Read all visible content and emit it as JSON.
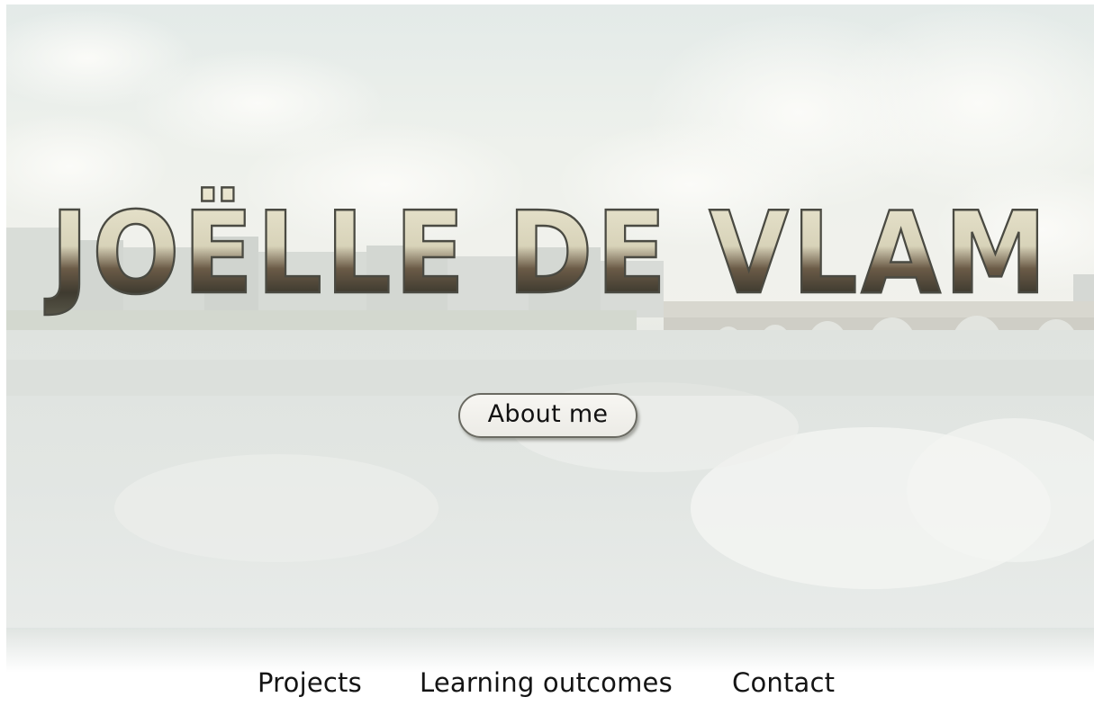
{
  "hero": {
    "title": "JOËLLE DE VLAM",
    "about_button": "About me",
    "title_fill_colors": [
      "#e4e0c8",
      "#5a4a38"
    ],
    "title_stroke_color": "#4a4a42"
  },
  "nav": {
    "items": [
      {
        "label": "Projects"
      },
      {
        "label": "Learning outcomes"
      },
      {
        "label": "Contact"
      }
    ]
  }
}
